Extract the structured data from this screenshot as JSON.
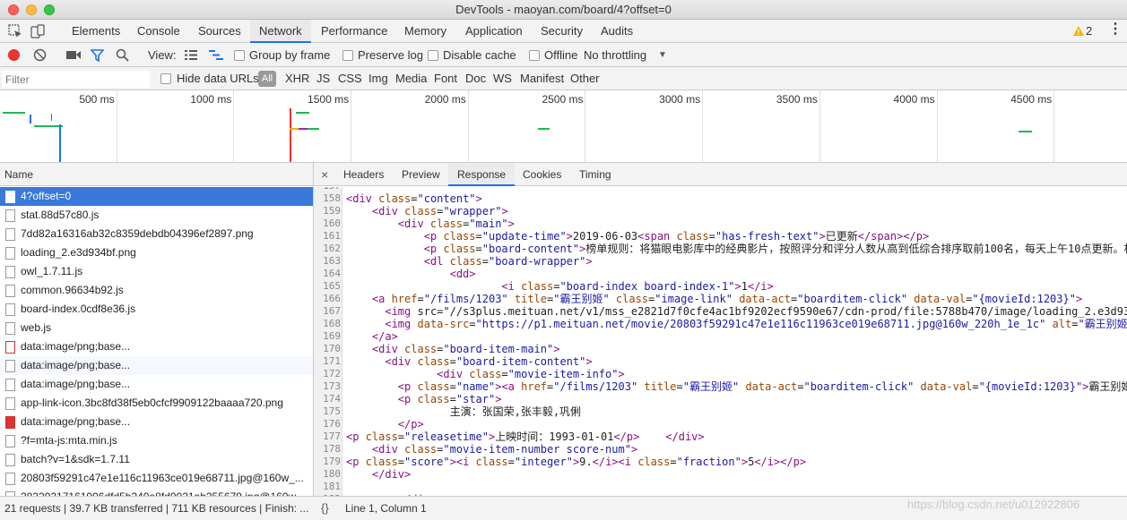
{
  "window": {
    "title": "DevTools - maoyan.com/board/4?offset=0"
  },
  "main_tabs": [
    "Elements",
    "Console",
    "Sources",
    "Network",
    "Performance",
    "Memory",
    "Application",
    "Security",
    "Audits"
  ],
  "active_main_tab": "Network",
  "warnings": {
    "count": "2"
  },
  "toolbar": {
    "view_label": "View:",
    "group_by_frame": "Group by frame",
    "preserve_log": "Preserve log",
    "disable_cache": "Disable cache",
    "offline": "Offline",
    "throttling": "No throttling"
  },
  "filter": {
    "placeholder": "Filter",
    "hide_data_urls": "Hide data URLs",
    "all": "All",
    "types": [
      "XHR",
      "JS",
      "CSS",
      "Img",
      "Media",
      "Font",
      "Doc",
      "WS",
      "Manifest",
      "Other"
    ]
  },
  "timeline": {
    "ticks": [
      "500 ms",
      "1000 ms",
      "1500 ms",
      "2000 ms",
      "2500 ms",
      "3000 ms",
      "3500 ms",
      "4000 ms",
      "4500 ms"
    ]
  },
  "requests": {
    "header": "Name",
    "items": [
      "4?offset=0",
      "stat.88d57c80.js",
      "7dd82a16316ab32c8359debdb04396ef2897.png",
      "loading_2.e3d934bf.png",
      "owl_1.7.11.js",
      "common.96634b92.js",
      "board-index.0cdf8e36.js",
      "web.js",
      "data:image/png;base...",
      "data:image/png;base...",
      "data:image/png;base...",
      "app-link-icon.3bc8fd38f5eb0cfcf9909122baaaa720.png",
      "data:image/png;base...",
      "?f=mta-js:mta.min.js",
      "batch?v=1&sdk=1.7.11",
      "20803f59291c47e1e116c11963ce019e68711.jpg@160w_...",
      "28329217161906dfd5b240a8fd9021ab255679.jpg@160w_..."
    ]
  },
  "detail_tabs": [
    "Headers",
    "Preview",
    "Response",
    "Cookies",
    "Timing"
  ],
  "active_detail_tab": "Response",
  "code_lines": [
    {
      "n": "157",
      "t": ""
    },
    {
      "n": "158",
      "t": "<div class=\"content\">"
    },
    {
      "n": "159",
      "t": "    <div class=\"wrapper\">"
    },
    {
      "n": "160",
      "t": "        <div class=\"main\">"
    },
    {
      "n": "161",
      "t": "            <p class=\"update-time\">2019-06-03<span class=\"has-fresh-text\">已更新</span></p>"
    },
    {
      "n": "162",
      "t": "            <p class=\"board-content\">榜单规则：将猫眼电影库中的经典影片，按照评分和评分人数从高到低综合排序取前100名，每天上午10点更新。相"
    },
    {
      "n": "163",
      "t": "            <dl class=\"board-wrapper\">"
    },
    {
      "n": "164",
      "t": "                <dd>"
    },
    {
      "n": "165",
      "t": "                        <i class=\"board-index board-index-1\">1</i>"
    },
    {
      "n": "166",
      "t": "    <a href=\"/films/1203\" title=\"霸王别姬\" class=\"image-link\" data-act=\"boarditem-click\" data-val=\"{movieId:1203}\">"
    },
    {
      "n": "167",
      "t": "      <img src=\"//s3plus.meituan.net/v1/mss_e2821d7f0cfe4ac1bf9202ecf9590e67/cdn-prod/file:5788b470/image/loading_2.e3d934"
    },
    {
      "n": "168",
      "t": "      <img data-src=\"https://p1.meituan.net/movie/20803f59291c47e1e116c11963ce019e68711.jpg@160w_220h_1e_1c\" alt=\"霸王别姬\""
    },
    {
      "n": "169",
      "t": "    </a>"
    },
    {
      "n": "170",
      "t": "    <div class=\"board-item-main\">"
    },
    {
      "n": "171",
      "t": "      <div class=\"board-item-content\">"
    },
    {
      "n": "172",
      "t": "              <div class=\"movie-item-info\">"
    },
    {
      "n": "173",
      "t": "        <p class=\"name\"><a href=\"/films/1203\" title=\"霸王别姬\" data-act=\"boarditem-click\" data-val=\"{movieId:1203}\">霸王别姬"
    },
    {
      "n": "174",
      "t": "        <p class=\"star\">"
    },
    {
      "n": "175",
      "t": "                主演：张国荣,张丰毅,巩俐"
    },
    {
      "n": "176",
      "t": "        </p>"
    },
    {
      "n": "177",
      "t": "<p class=\"releasetime\">上映时间：1993-01-01</p>    </div>"
    },
    {
      "n": "178",
      "t": "    <div class=\"movie-item-number score-num\">"
    },
    {
      "n": "179",
      "t": "<p class=\"score\"><i class=\"integer\">9.</i><i class=\"fraction\">5</i></p>"
    },
    {
      "n": "180",
      "t": "    </div>"
    },
    {
      "n": "181",
      "t": ""
    },
    {
      "n": "182",
      "t": "        </div>"
    }
  ],
  "status": {
    "summary": "21 requests | 39.7 KB transferred | 711 KB resources | Finish: ...",
    "format_icon": "{}",
    "cursor": "Line 1, Column 1"
  },
  "watermark": "https://blog.csdn.net/u012922806"
}
